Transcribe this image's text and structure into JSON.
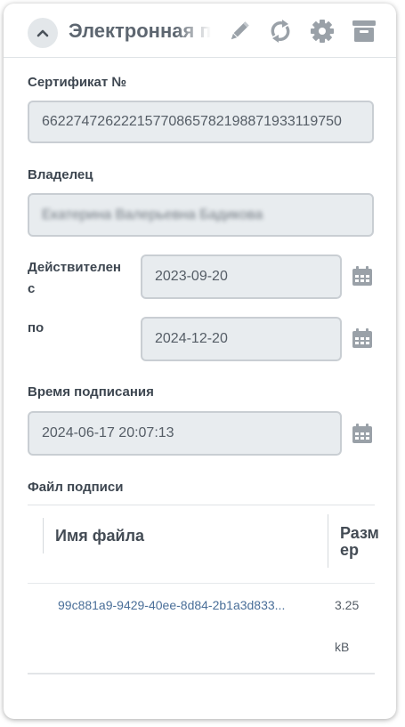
{
  "header": {
    "title": "Электронная подпись",
    "icons": [
      "chevron-up-icon",
      "pencil-icon",
      "refresh-icon",
      "gear-icon",
      "archive-icon"
    ]
  },
  "form": {
    "certificate_label": "Сертификат №",
    "certificate_value": "66227472622215770865782198871933119750",
    "owner_label": "Владелец",
    "owner_value": "Екатерина Валерьевна Бадикова",
    "valid_from_label_line1": "Действителен",
    "valid_from_label_line2": "с",
    "valid_from_value": "2023-09-20",
    "valid_to_label": "по",
    "valid_to_value": "2024-12-20",
    "signing_time_label": "Время подписания",
    "signing_time_value": "2024-06-17 20:07:13"
  },
  "files": {
    "section_label": "Файл подписи",
    "columns": {
      "name": "Имя файла",
      "size_line1": "Разм",
      "size_line2": "ер"
    },
    "rows": [
      {
        "name": "99c881a9-9429-40ee-8d84-2b1a3d833...",
        "size_line1": "3.25",
        "size_line2": "kB"
      }
    ]
  },
  "colors": {
    "field_bg": "#e8ecef",
    "field_border": "#c9ced3",
    "icon_gray": "#9aa1a8",
    "link": "#4a6f99"
  }
}
